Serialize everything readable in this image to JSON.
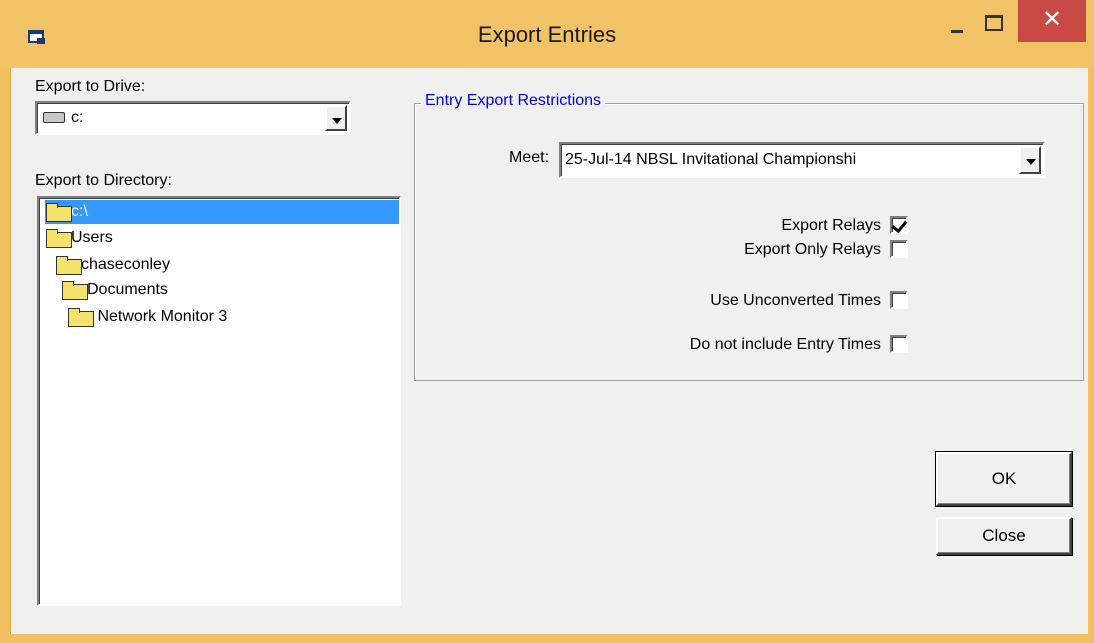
{
  "window": {
    "title": "Export Entries",
    "close_glyph": "✕"
  },
  "drive": {
    "label": "Export to Drive:",
    "value": "c:",
    "icon": "drive-icon"
  },
  "directory": {
    "label": "Export to Directory:",
    "items": [
      {
        "name": "c:\\",
        "selected": true
      },
      {
        "name": "Users"
      },
      {
        "name": "chaseconley"
      },
      {
        "name": "Documents"
      },
      {
        "name": "Network Monitor 3"
      }
    ]
  },
  "restrictions": {
    "legend": "Entry Export Restrictions",
    "meet_label": "Meet:",
    "meet_value": "25-Jul-14 NBSL Invitational Championshi",
    "options": [
      {
        "label": "Export Relays",
        "checked": true
      },
      {
        "label": "Export Only Relays",
        "checked": false
      },
      {
        "label": "Use Unconverted Times",
        "checked": false
      },
      {
        "label": "Do not include Entry Times",
        "checked": false
      }
    ]
  },
  "buttons": {
    "ok": "OK",
    "close": "Close"
  },
  "colors": {
    "titlebar": "#f2c266",
    "close_button": "#c94a45",
    "selection": "#3399ff",
    "legend_text": "#0000ee"
  }
}
